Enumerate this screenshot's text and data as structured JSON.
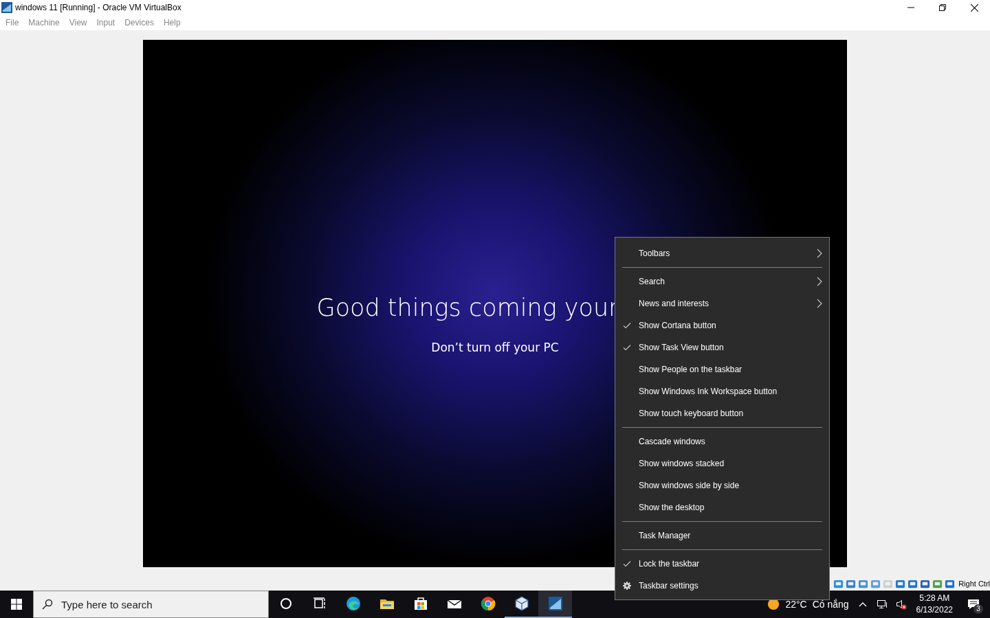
{
  "window": {
    "title": "windows 11 [Running] - Oracle VM VirtualBox",
    "menu": [
      "File",
      "Machine",
      "View",
      "Input",
      "Devices",
      "Help"
    ]
  },
  "vm_screen": {
    "heading": "Good things coming your",
    "subheading": "Don’t turn off your PC"
  },
  "context_menu": {
    "groups": [
      [
        {
          "label": "Toolbars",
          "kind": "submenu"
        }
      ],
      [
        {
          "label": "Search",
          "kind": "submenu"
        },
        {
          "label": "News and interests",
          "kind": "submenu"
        },
        {
          "label": "Show Cortana button",
          "kind": "check",
          "checked": true
        },
        {
          "label": "Show Task View button",
          "kind": "check",
          "checked": true
        },
        {
          "label": "Show People on the taskbar",
          "kind": "check",
          "checked": false
        },
        {
          "label": "Show Windows Ink Workspace button",
          "kind": "check",
          "checked": false
        },
        {
          "label": "Show touch keyboard button",
          "kind": "check",
          "checked": false
        }
      ],
      [
        {
          "label": "Cascade windows",
          "kind": "plain"
        },
        {
          "label": "Show windows stacked",
          "kind": "plain"
        },
        {
          "label": "Show windows side by side",
          "kind": "plain"
        },
        {
          "label": "Show the desktop",
          "kind": "plain"
        }
      ],
      [
        {
          "label": "Task Manager",
          "kind": "plain"
        }
      ],
      [
        {
          "label": "Lock the taskbar",
          "kind": "check",
          "checked": true
        },
        {
          "label": "Taskbar settings",
          "kind": "settings"
        }
      ]
    ]
  },
  "status_bar": {
    "host_key": "Right Ctrl"
  },
  "taskbar": {
    "search": {
      "placeholder": "Type here to search"
    },
    "apps": [
      {
        "kind": "cortana",
        "running": false,
        "selected": false
      },
      {
        "kind": "taskview",
        "running": false,
        "selected": false
      },
      {
        "kind": "edge",
        "running": false,
        "selected": false
      },
      {
        "kind": "explorer",
        "running": false,
        "selected": false
      },
      {
        "kind": "store",
        "running": false,
        "selected": false
      },
      {
        "kind": "mail",
        "running": false,
        "selected": false
      },
      {
        "kind": "chrome",
        "running": false,
        "selected": false
      },
      {
        "kind": "virtualbox",
        "running": true,
        "selected": false
      },
      {
        "kind": "vm",
        "running": true,
        "selected": true
      }
    ],
    "weather": {
      "temperature": "22°C",
      "condition": "Có nắng"
    },
    "clock": {
      "time": "5:28 AM",
      "date": "6/13/2022"
    },
    "notifications": {
      "count": "3"
    }
  }
}
